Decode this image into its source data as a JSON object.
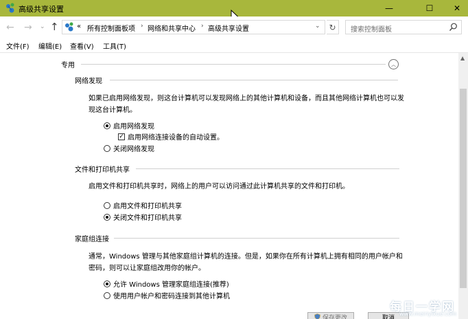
{
  "window": {
    "title": "高级共享设置",
    "min_glyph": "—",
    "max_glyph": "☐",
    "close_glyph": "✕",
    "titlebar_color": "#a8b73c"
  },
  "nav": {
    "back": "←",
    "forward": "→",
    "dropdown": "⌄",
    "up": "↑"
  },
  "address": {
    "prefix": "«",
    "crumbs": [
      "所有控制面板项",
      "网络和共享中心",
      "高级共享设置"
    ],
    "separator": "›",
    "dropdown": "⌄",
    "refresh": "↻"
  },
  "search": {
    "placeholder": "搜索控制面板"
  },
  "menu": [
    "文件(F)",
    "编辑(E)",
    "查看(V)",
    "工具(T)"
  ],
  "profile": {
    "title": "专用",
    "collapse_glyph": "︿",
    "groups": [
      {
        "title": "网络发现",
        "description": "如果已启用网络发现，则这台计算机可以发现网络上的其他计算机和设备，而且其他网络计算机也可以发现这台计算机。",
        "options": [
          {
            "label": "启用网络发现",
            "checked": true
          },
          {
            "label": "启用网络连接设备的自动设置。",
            "checked": true,
            "kind": "checkbox"
          },
          {
            "label": "关闭网络发现",
            "checked": false
          }
        ]
      },
      {
        "title": "文件和打印机共享",
        "description": "启用文件和打印机共享时，网络上的用户可以访问通过此计算机共享的文件和打印机。",
        "options": [
          {
            "label": "启用文件和打印机共享",
            "checked": false
          },
          {
            "label": "关闭文件和打印机共享",
            "checked": true
          }
        ]
      },
      {
        "title": "家庭组连接",
        "description": "通常，Windows 管理与其他家庭组计算机的连接。但是，如果你在所有计算机上拥有相同的用户帐户和密码，则可以让家庭组改用你的帐户。",
        "options": [
          {
            "label": "允许 Windows 管理家庭组连接(推荐)",
            "checked": true
          },
          {
            "label": "使用用户帐户和密码连接到其他计算机",
            "checked": false
          }
        ]
      }
    ]
  },
  "footer": {
    "save_label": "保存更改",
    "cancel_label": "取消"
  },
  "watermark": {
    "text": "每日一学网",
    "url": "www.meiriyixue.com"
  },
  "check_glyph": "✓",
  "scroll_up_glyph": "▲"
}
